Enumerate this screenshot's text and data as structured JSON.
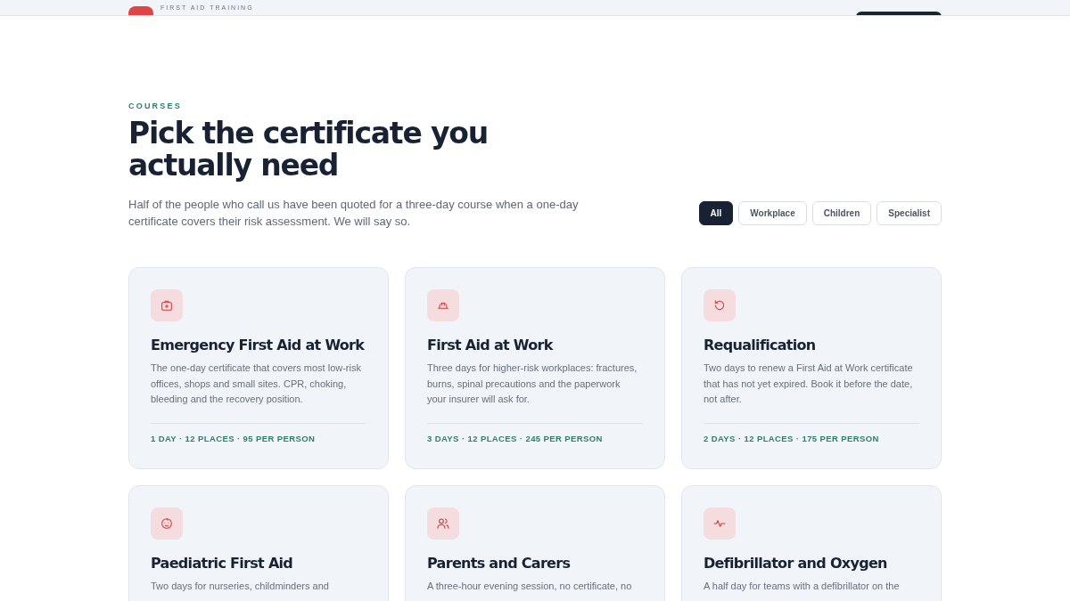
{
  "header": {
    "tagline": "FIRST AID TRAINING"
  },
  "section": {
    "eyebrow": "COURSES",
    "title": "Pick the certificate you actually need",
    "intro": "Half of the people who call us have been quoted for a three-day course when a one-day certificate covers their risk assessment. We will say so."
  },
  "filters": [
    {
      "label": "All",
      "selected": true
    },
    {
      "label": "Workplace",
      "selected": false
    },
    {
      "label": "Children",
      "selected": false
    },
    {
      "label": "Specialist",
      "selected": false
    }
  ],
  "courses": [
    {
      "title": "Emergency First Aid at Work",
      "description": "The one-day certificate that covers most low-risk offices, shops and small sites. CPR, choking, bleeding and the recovery position.",
      "meta": "1 DAY · 12 PLACES · 95 PER PERSON"
    },
    {
      "title": "First Aid at Work",
      "description": "Three days for higher-risk workplaces: fractures, burns, spinal precautions and the paperwork your insurer will ask for.",
      "meta": "3 DAYS · 12 PLACES · 245 PER PERSON"
    },
    {
      "title": "Requalification",
      "description": "Two days to renew a First Aid at Work certificate that has not yet expired. Book it before the date, not after.",
      "meta": "2 DAYS · 12 PLACES · 175 PER PERSON"
    },
    {
      "title": "Paediatric First Aid",
      "description": "Two days for nurseries, childminders and"
    },
    {
      "title": "Parents and Carers",
      "description": "A three-hour evening session, no certificate, no"
    },
    {
      "title": "Defibrillator and Oxygen",
      "description": "A half day for teams with a defibrillator on the"
    }
  ]
}
